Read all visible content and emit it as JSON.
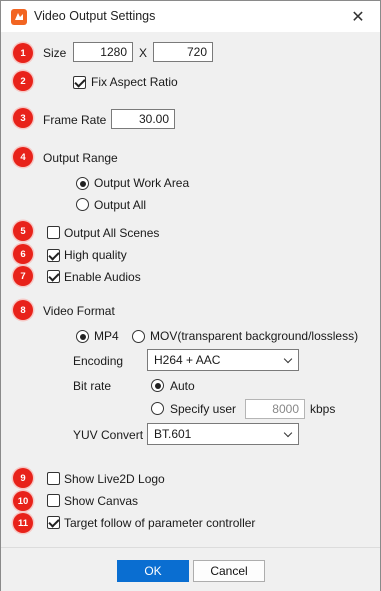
{
  "window": {
    "title": "Video Output Settings",
    "app_icon": "app-logo-icon",
    "close_icon": "close-icon",
    "close_glyph": "✕"
  },
  "badges": [
    "1",
    "2",
    "3",
    "4",
    "5",
    "6",
    "7",
    "8",
    "9",
    "10",
    "11"
  ],
  "size": {
    "label": "Size",
    "width": "1280",
    "separator": "X",
    "height": "720"
  },
  "fix_aspect": {
    "label": "Fix Aspect Ratio",
    "checked": true
  },
  "frame_rate": {
    "label": "Frame Rate",
    "value": "30.00"
  },
  "output_range": {
    "label": "Output Range",
    "options": [
      {
        "label": "Output Work Area",
        "selected": true
      },
      {
        "label": "Output All",
        "selected": false
      }
    ]
  },
  "output_all_scenes": {
    "label": "Output All Scenes",
    "checked": false
  },
  "high_quality": {
    "label": "High quality",
    "checked": true
  },
  "enable_audios": {
    "label": "Enable Audios",
    "checked": true
  },
  "video_format": {
    "label": "Video Format",
    "formats": [
      {
        "label": "MP4",
        "selected": true
      },
      {
        "label": "MOV(transparent background/lossless)",
        "selected": false
      }
    ],
    "encoding": {
      "label": "Encoding",
      "value": "H264 + AAC"
    },
    "bitrate": {
      "label": "Bit rate",
      "auto_label": "Auto",
      "auto_selected": true,
      "specify_label": "Specify user",
      "specify_selected": false,
      "value": "8000",
      "unit": "kbps"
    },
    "yuv": {
      "label": "YUV Convert",
      "value": "BT.601"
    }
  },
  "show_live2d_logo": {
    "label": "Show Live2D Logo",
    "checked": false
  },
  "show_canvas": {
    "label": "Show Canvas",
    "checked": false
  },
  "target_follow": {
    "label": "Target follow of parameter controller",
    "checked": true
  },
  "buttons": {
    "ok": "OK",
    "cancel": "Cancel"
  },
  "colors": {
    "badge": "#e8221a",
    "primary_button": "#0a6ed1",
    "app_icon": "#f26522"
  }
}
